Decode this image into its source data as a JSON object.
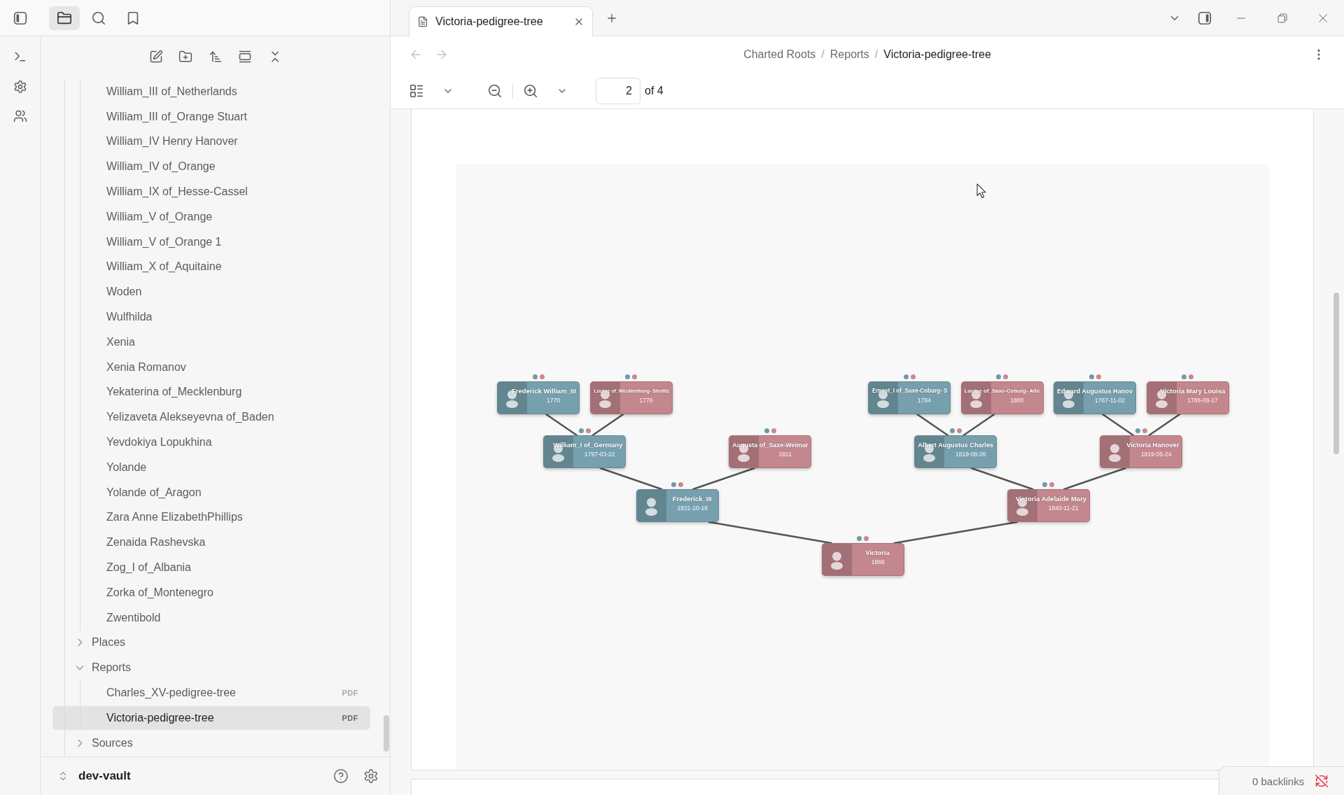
{
  "sidebar_tabs": [
    {
      "kind": "files",
      "selected": true
    },
    {
      "kind": "search",
      "selected": false
    },
    {
      "kind": "bookmarks",
      "selected": false
    }
  ],
  "file_tree": [
    {
      "children": [
        {
          "children": [
            {
              "kind": "file",
              "label": "William_III of_Netherlands",
              "selected": false
            },
            {
              "kind": "file",
              "label": "William_III of_Orange Stuart",
              "selected": false
            },
            {
              "kind": "file",
              "label": "William_IV Henry Hanover",
              "selected": false
            },
            {
              "kind": "file",
              "label": "William_IV of_Orange",
              "selected": false
            },
            {
              "kind": "file",
              "label": "William_IX of_Hesse-Cassel",
              "selected": false
            },
            {
              "kind": "file",
              "label": "William_V of_Orange",
              "selected": false
            },
            {
              "kind": "file",
              "label": "William_V of_Orange 1",
              "selected": false
            },
            {
              "kind": "file",
              "label": "William_X of_Aquitaine",
              "selected": false
            },
            {
              "kind": "file",
              "label": "Woden",
              "selected": false
            },
            {
              "kind": "file",
              "label": "Wulfhilda",
              "selected": false
            },
            {
              "kind": "file",
              "label": "Xenia",
              "selected": false
            },
            {
              "kind": "file",
              "label": "Xenia Romanov",
              "selected": false
            },
            {
              "kind": "file",
              "label": "Yekaterina of_Mecklenburg",
              "selected": false
            },
            {
              "kind": "file",
              "label": "Yelizaveta Alekseyevna of_Baden",
              "selected": false
            },
            {
              "kind": "file",
              "label": "Yevdokiya Lopukhina",
              "selected": false
            },
            {
              "kind": "file",
              "label": "Yolande",
              "selected": false
            },
            {
              "kind": "file",
              "label": "Yolande of_Aragon",
              "selected": false
            },
            {
              "kind": "file",
              "label": "Zara Anne ElizabethPhillips",
              "selected": false
            },
            {
              "kind": "file",
              "label": "Zenaida Rashevska",
              "selected": false
            },
            {
              "kind": "file",
              "label": "Zog_I of_Albania",
              "selected": false
            },
            {
              "kind": "file",
              "label": "Zorka of_Montenegro",
              "selected": false
            },
            {
              "kind": "file",
              "label": "Zwentibold",
              "selected": false
            }
          ]
        },
        {
          "kind": "folder",
          "label": "Places",
          "expanded": false,
          "selected": false
        },
        {
          "kind": "folder",
          "label": "Reports",
          "expanded": true,
          "selected": false,
          "children": [
            {
              "kind": "file",
              "label": "Charles_XV-pedigree-tree",
              "badge": "PDF",
              "selected": false
            },
            {
              "kind": "file",
              "label": "Victoria-pedigree-tree",
              "badge": "PDF",
              "selected": true
            }
          ]
        },
        {
          "kind": "folder",
          "label": "Sources",
          "expanded": false,
          "selected": false
        }
      ]
    }
  ],
  "vault": {
    "name": "dev-vault"
  },
  "tabs": [
    {
      "title": "Victoria-pedigree-tree",
      "selected": true
    }
  ],
  "navigation": [
    {
      "kind": "back",
      "disabled": true
    },
    {
      "kind": "forward",
      "disabled": true
    }
  ],
  "breadcrumb": [
    {
      "kind": "link",
      "text": "Charted Roots"
    },
    {
      "kind": "separator",
      "text": "/"
    },
    {
      "kind": "link",
      "text": "Reports"
    },
    {
      "kind": "separator",
      "text": "/"
    },
    {
      "kind": "current",
      "text": "Victoria-pedigree-tree"
    }
  ],
  "pdf_toolbar": {
    "page": "2",
    "page_total": "of 4"
  },
  "pedigree": {
    "name": "Victoria",
    "date": "1866",
    "color": "#c4878e",
    "parents": [
      {
        "name": "Frederick_III",
        "date": "1831-10-18",
        "color": "#77a0ae",
        "parents": [
          {
            "name": "William_I of_Germany",
            "date": "1797-03-22",
            "color": "#77a0ae",
            "parents": [
              {
                "name": "Frederick William_III",
                "date": "1770",
                "color": "#77a0ae"
              },
              {
                "name": "Louise of_Mecklenburg- Strelitz",
                "date": "1776",
                "color": "#c4878e"
              }
            ]
          },
          {
            "name": "Augusta of_Saxe-Weimar",
            "date": "1811",
            "color": "#c4878e"
          }
        ]
      },
      {
        "name": "Victoria Adelaide Mary",
        "date": "1840-11-21",
        "color": "#c4878e",
        "parents": [
          {
            "name": "Albert Augustus Charles",
            "date": "1819-08-26",
            "color": "#77a0ae",
            "parents": [
              {
                "name": "Ernest_I of_Saxe-Coburg- S",
                "date": "1784",
                "color": "#77a0ae"
              },
              {
                "name": "Louise of_Saxe-Coburg- Alte",
                "date": "1800",
                "color": "#c4878e"
              }
            ]
          },
          {
            "name": "Victoria Hanover",
            "date": "1819-05-24",
            "color": "#c4878e",
            "parents": [
              {
                "name": "Edward Augustus Hanov",
                "date": "1767-11-02",
                "color": "#77a0ae"
              },
              {
                "name": "Victoria Mary Louisa",
                "date": "1786-08-17",
                "color": "#c4878e"
              }
            ]
          }
        ]
      }
    ]
  },
  "backlinks": {
    "label": "0 backlinks"
  }
}
